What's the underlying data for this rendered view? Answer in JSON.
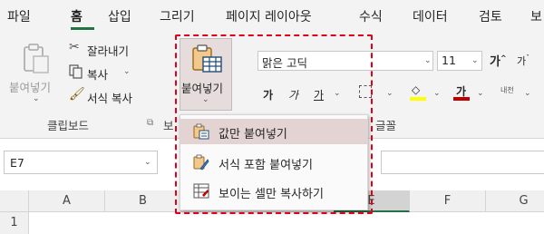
{
  "tabs": [
    "파일",
    "홈",
    "삽입",
    "그리기",
    "페이지 레이아웃",
    "수식",
    "데이터",
    "검토",
    "보"
  ],
  "clipboard": {
    "paste_label": "붙여넣기",
    "cut_label": "잘라내기",
    "copy_label": "복사",
    "format_painter_label": "서식 복사",
    "group_label": "클립보드",
    "paste_dropdown_label": "붙여넣기"
  },
  "font": {
    "font_name": "맑은 고딕",
    "font_size": "11",
    "increase_label": "가",
    "decrease_label": "가",
    "bold_label": "가",
    "italic_label": "가",
    "underline_label": "가",
    "font_color_label": "가",
    "phonetic_label": "내천",
    "group_label": "글꼴"
  },
  "paste_menu": {
    "items": [
      "값만 붙여넣기",
      "서식 포함 붙여넣기",
      "보이는 셀만 복사하기"
    ]
  },
  "formula_bar": {
    "name_box": "E7"
  },
  "columns": [
    "A",
    "B",
    "E",
    "F",
    "G"
  ],
  "rows": [
    "1"
  ],
  "colors": {
    "accent": "#217346",
    "highlight_frame": "#e0001b",
    "menu_highlight": "#e3d3d3",
    "font_color_red": "#c00000",
    "fill_yellow": "#ffff00"
  }
}
